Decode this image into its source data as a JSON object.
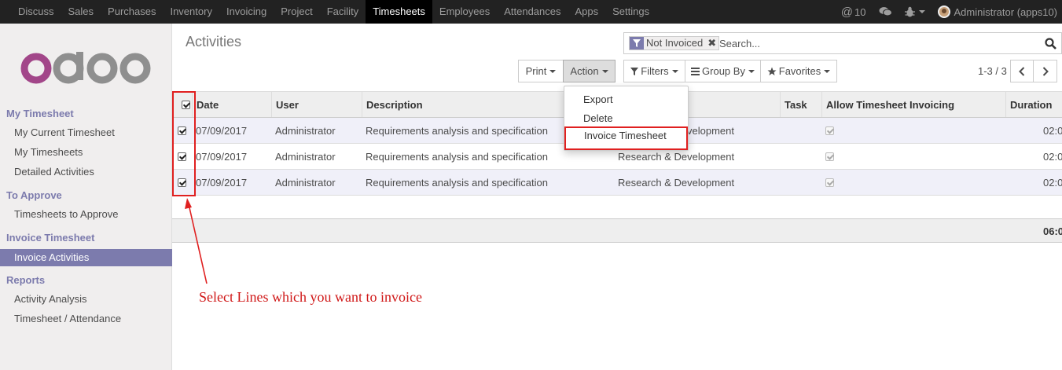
{
  "topbar": {
    "menu": [
      "Discuss",
      "Sales",
      "Purchases",
      "Inventory",
      "Invoicing",
      "Project",
      "Facility",
      "Timesheets",
      "Employees",
      "Attendances",
      "Apps",
      "Settings"
    ],
    "active_menu": "Timesheets",
    "messages_count": "10",
    "user": "Administrator (apps10)"
  },
  "sidebar": {
    "sections": [
      {
        "title": "My Timesheet",
        "items": [
          "My Current Timesheet",
          "My Timesheets",
          "Detailed Activities"
        ]
      },
      {
        "title": "To Approve",
        "items": [
          "Timesheets to Approve"
        ]
      },
      {
        "title": "Invoice Timesheet",
        "items": [
          "Invoice Activities"
        ]
      },
      {
        "title": "Reports",
        "items": [
          "Activity Analysis",
          "Timesheet / Attendance"
        ]
      }
    ],
    "active_item": "Invoice Activities"
  },
  "main": {
    "breadcrumb": "Activities",
    "search": {
      "facet": "Not Invoiced",
      "placeholder": "Search..."
    },
    "buttons": {
      "print": "Print",
      "action": "Action",
      "filters": "Filters",
      "group_by": "Group By",
      "favorites": "Favorites"
    },
    "pager": "1-3 / 3"
  },
  "action_menu": [
    "Export",
    "Delete",
    "Invoice Timesheet"
  ],
  "table": {
    "columns": [
      "Date",
      "User",
      "Description",
      "Task",
      "Allow Timesheet Invoicing",
      "Duration"
    ],
    "rows": [
      {
        "date": "07/09/2017",
        "user": "Administrator",
        "description": "Requirements analysis and specification",
        "project": "Research & Development",
        "duration": "02:0"
      },
      {
        "date": "07/09/2017",
        "user": "Administrator",
        "description": "Requirements analysis and specification",
        "project": "Research & Development",
        "duration": "02:0"
      },
      {
        "date": "07/09/2017",
        "user": "Administrator",
        "description": "Requirements analysis and specification",
        "project": "Research & Development",
        "duration": "02:0"
      }
    ],
    "row_project_visible": [
      "velopment",
      "Research & Development",
      "Research & Development"
    ],
    "total_duration": "06:0"
  },
  "annotation": {
    "text": "Select Lines which you want to invoice"
  },
  "colors": {
    "brand": "#7c7bad",
    "annotation": "#e02020",
    "navbar": "#222222"
  }
}
